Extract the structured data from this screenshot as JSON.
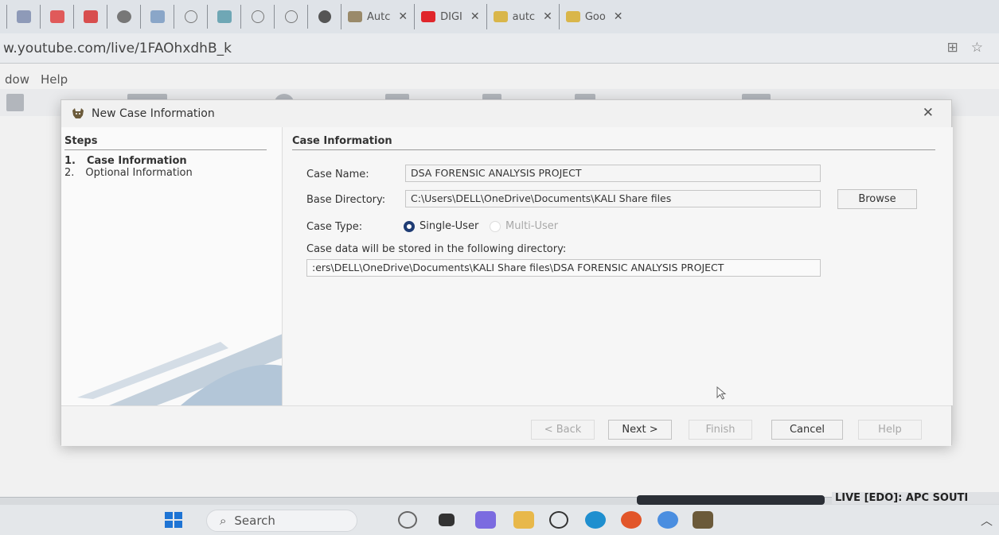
{
  "browser": {
    "tabs": [
      {
        "title": "Autc"
      },
      {
        "title": "DIGI"
      },
      {
        "title": "autc"
      },
      {
        "title": "Goo"
      }
    ],
    "url": "w.youtube.com/live/1FAOhxdhB_k"
  },
  "app": {
    "menu": [
      "dow",
      "Help"
    ]
  },
  "dialog": {
    "title": "New Case Information",
    "steps_heading": "Steps",
    "steps": [
      {
        "num": "1.",
        "label": "Case Information"
      },
      {
        "num": "2.",
        "label": "Optional Information"
      }
    ],
    "section_heading": "Case Information",
    "case_name_label": "Case Name:",
    "case_name_value": "DSA FORENSIC ANALYSIS PROJECT",
    "base_dir_label": "Base Directory:",
    "base_dir_value": "C:\\Users\\DELL\\OneDrive\\Documents\\KALI Share files",
    "browse_label": "Browse",
    "case_type_label": "Case Type:",
    "single_user_label": "Single-User",
    "multi_user_label": "Multi-User",
    "storage_note": "Case data will be stored in the following directory:",
    "storage_path": ":ers\\DELL\\OneDrive\\Documents\\KALI Share files\\DSA FORENSIC ANALYSIS PROJECT",
    "buttons": {
      "back": "< Back",
      "next": "Next >",
      "finish": "Finish",
      "cancel": "Cancel",
      "help": "Help"
    }
  },
  "bottom": {
    "live_text": "LIVE [EDO]: APC SOUTI"
  },
  "taskbar": {
    "search_label": "Search"
  }
}
